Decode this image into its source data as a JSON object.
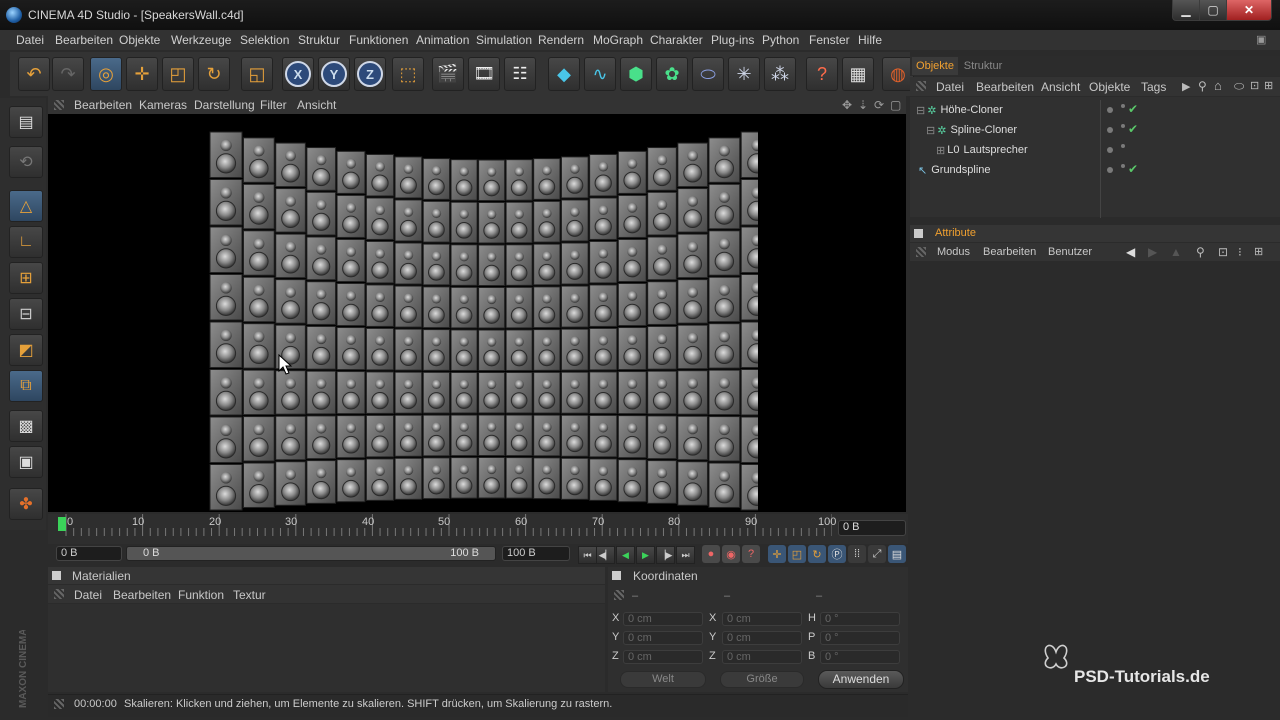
{
  "window": {
    "title": "CINEMA 4D Studio - [SpeakersWall.c4d]",
    "minimize": "▁",
    "maximize": "▢",
    "close": "✕"
  },
  "menu": [
    "Datei",
    "Bearbeiten",
    "Objekte",
    "Werkzeuge",
    "Selektion",
    "Struktur",
    "Funktionen",
    "Animation",
    "Simulation",
    "Rendern",
    "MoGraph",
    "Charakter",
    "Plug-ins",
    "Python",
    "Fenster",
    "Hilfe"
  ],
  "toolbar_icons": [
    "undo-icon",
    "redo-icon",
    "live-selection-icon",
    "move-icon",
    "scale-icon",
    "rotate-icon",
    "model-mode-icon",
    "x-axis-icon",
    "y-axis-icon",
    "z-axis-icon",
    "coordinate-system-icon",
    "render-view-icon",
    "render-picture-viewer-icon",
    "render-settings-icon",
    "cube-icon",
    "spline-icon",
    "subdivision-surface-icon",
    "cloner-icon",
    "deformer-icon",
    "scene-icon",
    "particles-icon",
    "help-icon",
    "timeline-icon",
    "globe-icon"
  ],
  "axis_labels": [
    "X",
    "Y",
    "Z"
  ],
  "viewport": {
    "menu": [
      "Bearbeiten",
      "Kameras",
      "Darstellung",
      "Filter",
      "Ansicht"
    ]
  },
  "timeline": {
    "ticks": [
      "0",
      "10",
      "20",
      "30",
      "40",
      "50",
      "60",
      "70",
      "80",
      "90",
      "100"
    ],
    "current_frame": "0 B",
    "start_field": "0 B",
    "range_start": "0 B",
    "range_end": "100 B",
    "end_field": "100 B"
  },
  "materials": {
    "title": "Materialien",
    "menu": [
      "Datei",
      "Bearbeiten",
      "Funktion",
      "Textur"
    ]
  },
  "coordinates": {
    "title": "Koordinaten",
    "col_headers": [
      "–",
      "–",
      "–"
    ],
    "rows": [
      {
        "a": "X",
        "av": "0 cm",
        "b": "X",
        "bv": "0 cm",
        "c": "H",
        "cv": "0 °"
      },
      {
        "a": "Y",
        "av": "0 cm",
        "b": "Y",
        "bv": "0 cm",
        "c": "P",
        "cv": "0 °"
      },
      {
        "a": "Z",
        "av": "0 cm",
        "b": "Z",
        "bv": "0 cm",
        "c": "B",
        "cv": "0 °"
      }
    ],
    "space": "Welt",
    "size_mode": "Größe",
    "apply": "Anwenden"
  },
  "status": {
    "time": "00:00:00",
    "message": "Skalieren: Klicken und ziehen, um Elemente zu skalieren. SHIFT drücken, um Skalierung zu rastern."
  },
  "objects": {
    "tabs": [
      "Objekte",
      "Struktur"
    ],
    "menu": [
      "Datei",
      "Bearbeiten",
      "Ansicht",
      "Objekte",
      "Tags"
    ],
    "items": [
      {
        "name": "Höhe-Cloner",
        "enabled": true
      },
      {
        "name": "Spline-Cloner",
        "enabled": true
      },
      {
        "name": "Lautsprecher",
        "enabled": false
      },
      {
        "name": "Grundspline",
        "enabled": true
      }
    ]
  },
  "attributes": {
    "title": "Attribute",
    "menu": [
      "Modus",
      "Bearbeiten",
      "Benutzer"
    ]
  },
  "branding": {
    "side_logo": "MAXON CINEMA 4D",
    "watermark": "PSD-Tutorials.de"
  },
  "colors": {
    "accent": "#f0a030",
    "check": "#5ac86a",
    "playhead": "#3bd35a"
  }
}
